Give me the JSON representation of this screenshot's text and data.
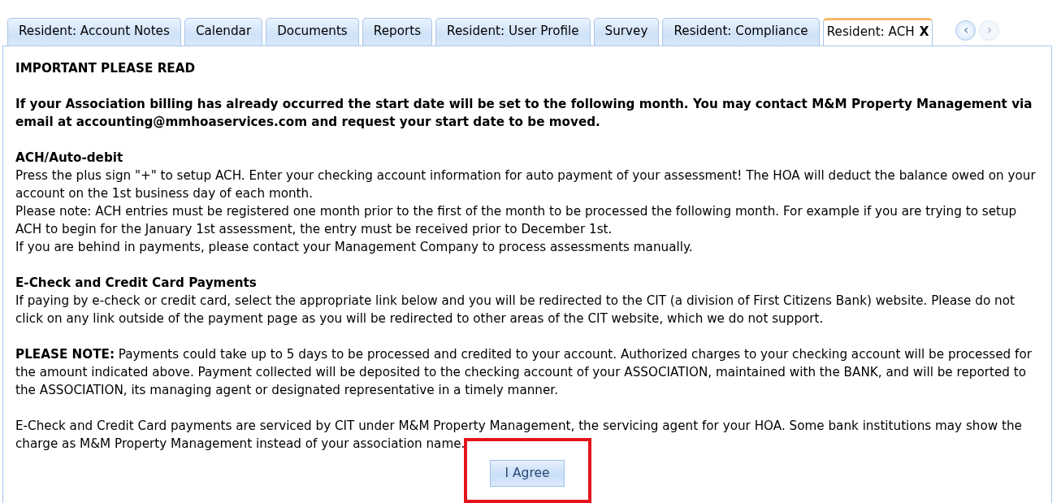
{
  "tabs": [
    {
      "label": "Resident: Account Notes",
      "selected": false
    },
    {
      "label": "Calendar",
      "selected": false
    },
    {
      "label": "Documents",
      "selected": false
    },
    {
      "label": "Reports",
      "selected": false
    },
    {
      "label": "Resident: User Profile",
      "selected": false
    },
    {
      "label": "Survey",
      "selected": false
    },
    {
      "label": "Resident: Compliance",
      "selected": false
    },
    {
      "label": "Resident: ACH",
      "selected": true,
      "close": "X"
    }
  ],
  "tab_scroll": [
    {
      "label": "‹",
      "disabled": false
    },
    {
      "label": "›",
      "disabled": true
    }
  ],
  "sections": [
    {
      "heading": "IMPORTANT PLEASE READ"
    },
    {
      "heading": "If your Association billing has already occurred the start date will be set to the following month. You may contact M&M Property Management via email at accounting@mmhoaservices.com and request your start date to be moved."
    },
    {
      "heading": "ACH/Auto-debit",
      "lines": [
        "Press the plus sign \"+\" to setup ACH. Enter your checking account information for auto payment of your assessment! The HOA will deduct the balance owed on your account on the 1st business day of each month.",
        "Please note: ACH entries must be registered one month prior to the first of the month to be processed the following month. For example if you are trying to setup ACH to begin for the January 1st assessment, the entry must be received prior to December 1st.",
        "If you are behind in payments, please contact your Management Company to process assessments manually."
      ]
    },
    {
      "heading": "E-Check and Credit Card Payments",
      "lines": [
        "If paying by e-check or credit card, select the appropriate link below and you will be redirected to the CIT (a division of First Citizens Bank) website. Please do not click on any link outside of the payment page as you will be redirected to other areas of the CIT website, which we do not support."
      ]
    },
    {
      "lines": [
        "**PLEASE NOTE:** Payments could take up to 5 days to be processed and credited to your account. Authorized charges to your checking account will be processed for the amount indicated above. Payment collected will be deposited to the checking account of your ASSOCIATION, maintained with the BANK, and will be reported to the ASSOCIATION, its managing agent or designated representative in a timely manner."
      ]
    },
    {
      "lines": [
        "E-Check and Credit Card payments are serviced by CIT under M&M Property Management, the servicing agent for your HOA. Some bank institutions may show the charge as M&M Property Management instead of your association name."
      ]
    }
  ],
  "agree_button": "I Agree"
}
